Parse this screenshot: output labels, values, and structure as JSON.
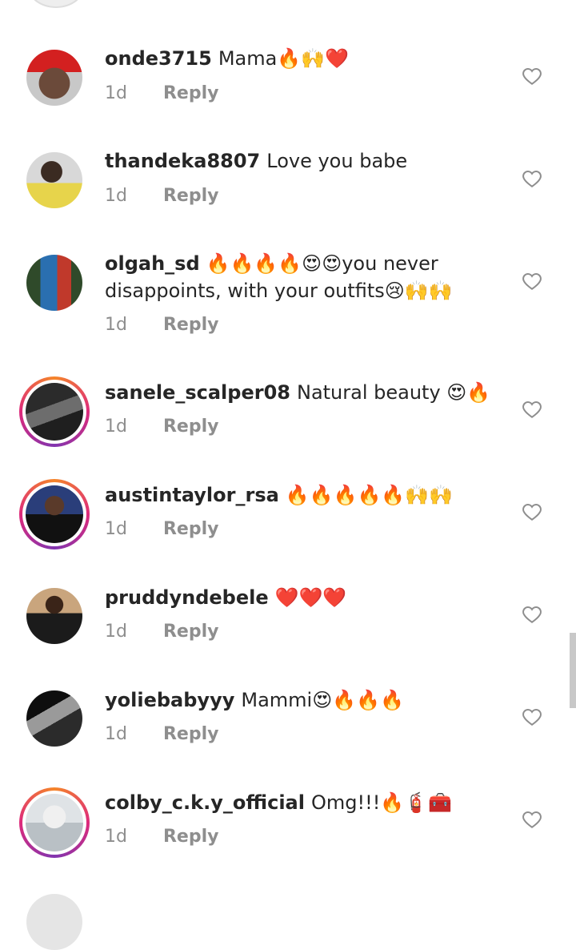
{
  "comments": [
    {
      "username": "onde3715",
      "text": "Mama🔥🙌❤️",
      "time": "1d",
      "reply": "Reply"
    },
    {
      "username": "thandeka8807",
      "text": "Love you babe",
      "time": "1d",
      "reply": "Reply"
    },
    {
      "username": "olgah_sd",
      "text": "🔥🔥🔥🔥😍😍you never disappoints, with your outfits😢🙌🙌",
      "time": "1d",
      "reply": "Reply"
    },
    {
      "username": "sanele_scalper08",
      "text": "Natural beauty 😍🔥",
      "time": "1d",
      "reply": "Reply"
    },
    {
      "username": "austintaylor_rsa",
      "text": "🔥🔥🔥🔥🔥🙌🙌",
      "time": "1d",
      "reply": "Reply"
    },
    {
      "username": "pruddyndebele",
      "text": "❤️❤️❤️",
      "time": "1d",
      "reply": "Reply"
    },
    {
      "username": "yoliebabyyy",
      "text": "Mammi😍🔥🔥🔥",
      "time": "1d",
      "reply": "Reply"
    },
    {
      "username": "colby_c.k.y_official",
      "text": "Omg!!!🔥🧯🧰",
      "time": "1d",
      "reply": "Reply"
    }
  ],
  "colors": {
    "text": "#262626",
    "secondary": "#8e8e8e",
    "story_ring_start": "#f58529",
    "story_ring_end": "#dd2a7b"
  }
}
